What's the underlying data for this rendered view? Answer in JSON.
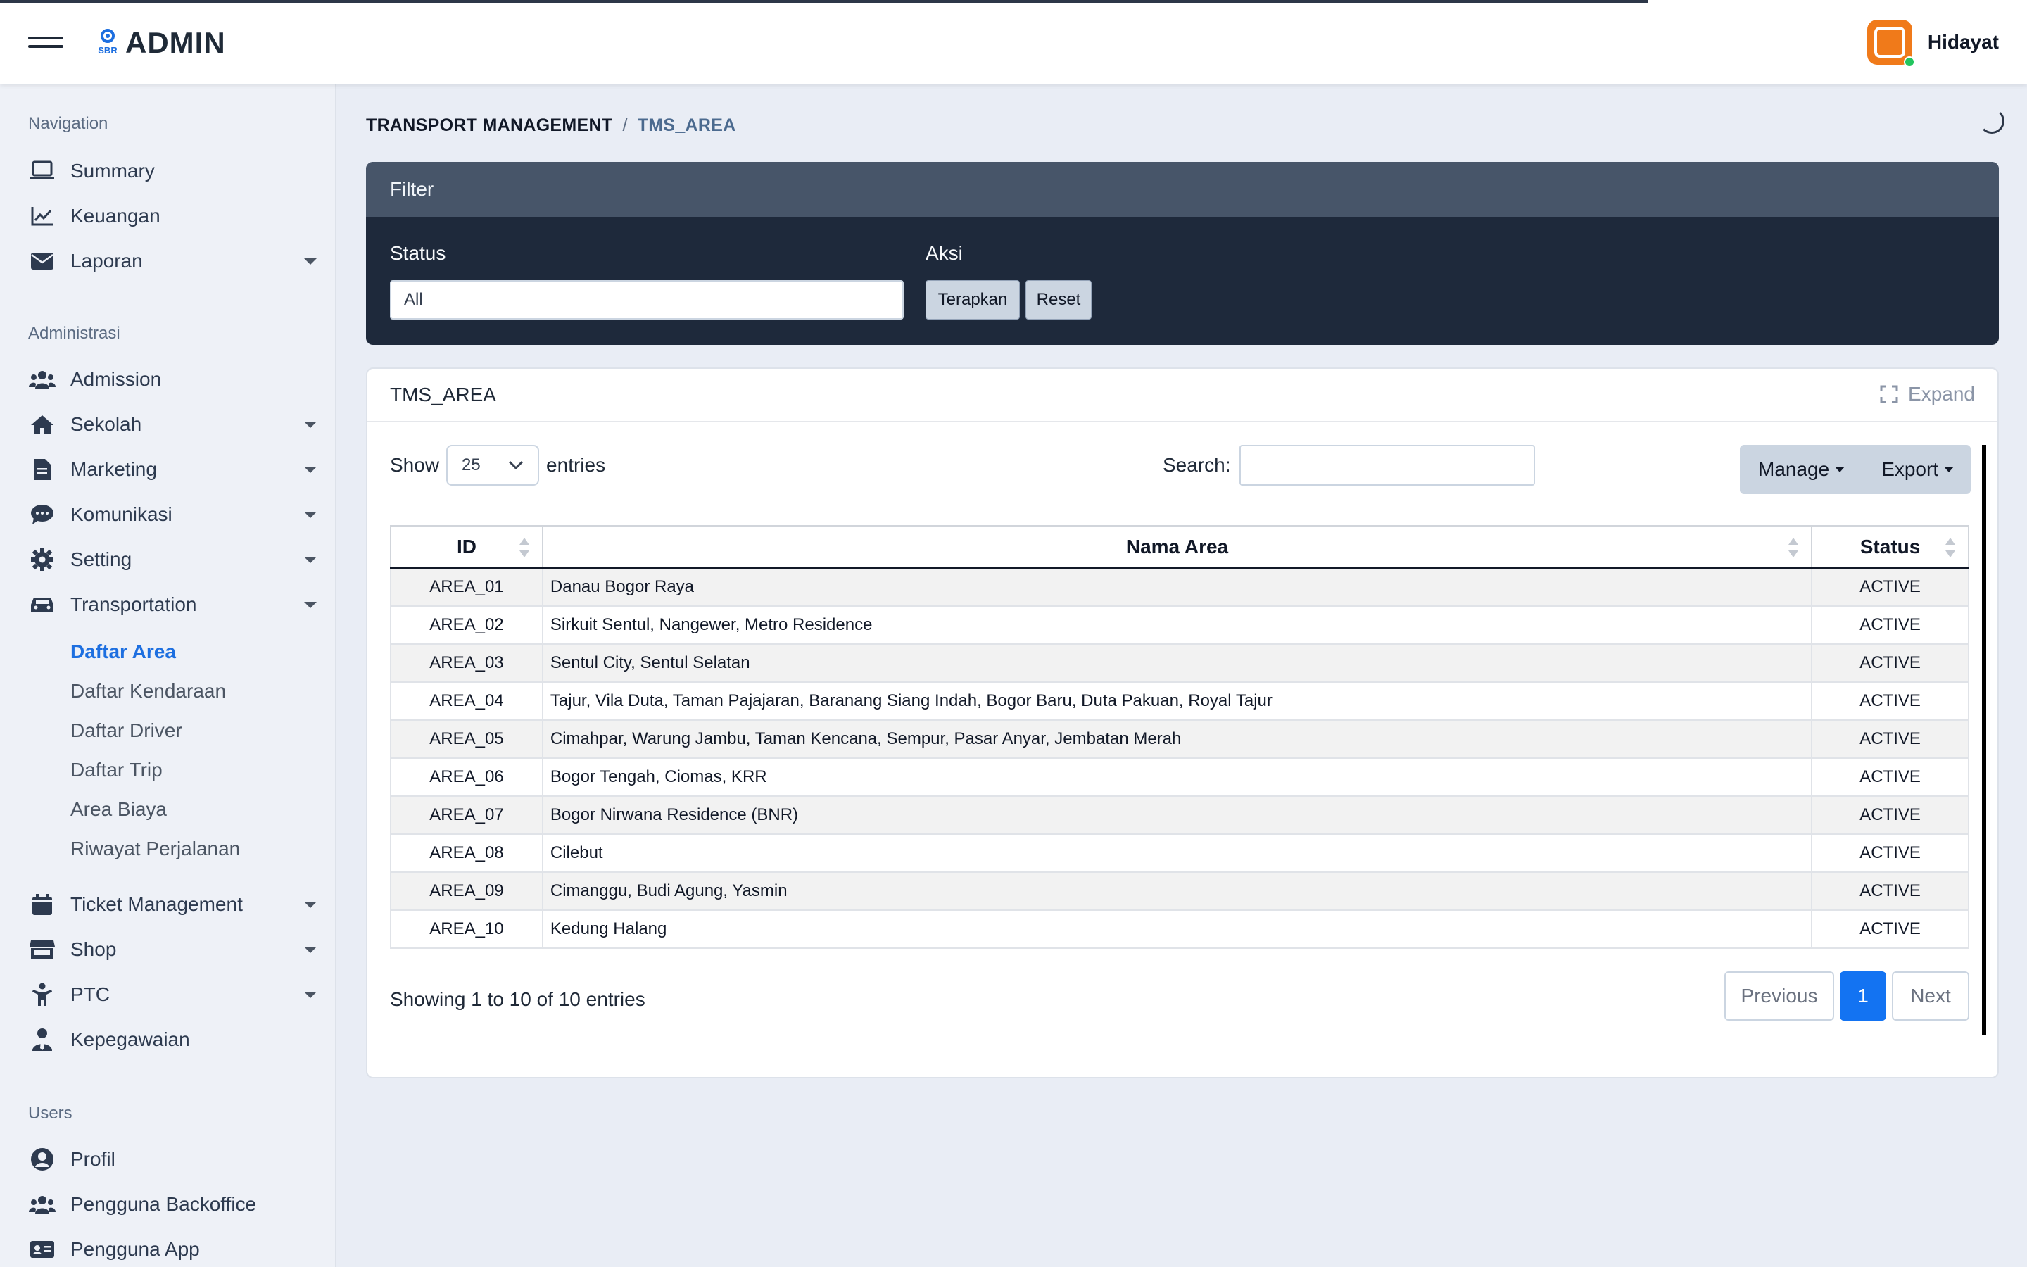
{
  "header": {
    "logo_mark": "SBR",
    "logo_text": "ADMIN",
    "user_name": "Hidayat"
  },
  "sidebar": {
    "sections": [
      {
        "title": "Navigation"
      },
      {
        "title": "Administrasi"
      },
      {
        "title": "Users"
      }
    ],
    "items": [
      {
        "label": "Summary",
        "icon": "laptop-icon"
      },
      {
        "label": "Keuangan",
        "icon": "chart-line-icon"
      },
      {
        "label": "Laporan",
        "icon": "envelope-icon"
      },
      {
        "label": "Admission",
        "icon": "users-icon"
      },
      {
        "label": "Sekolah",
        "icon": "home-icon"
      },
      {
        "label": "Marketing",
        "icon": "document-icon"
      },
      {
        "label": "Komunikasi",
        "icon": "chat-icon"
      },
      {
        "label": "Setting",
        "icon": "gear-icon"
      },
      {
        "label": "Transportation",
        "icon": "car-icon"
      },
      {
        "label": "Ticket Management",
        "icon": "calendar-icon"
      },
      {
        "label": "Shop",
        "icon": "store-icon"
      },
      {
        "label": "PTC",
        "icon": "child-icon"
      },
      {
        "label": "Kepegawaian",
        "icon": "user-tie-icon"
      },
      {
        "label": "Profil",
        "icon": "user-circle-icon"
      },
      {
        "label": "Pengguna Backoffice",
        "icon": "users-icon"
      },
      {
        "label": "Pengguna App",
        "icon": "id-card-icon"
      }
    ],
    "transport_sub": [
      {
        "label": "Daftar Area"
      },
      {
        "label": "Daftar Kendaraan"
      },
      {
        "label": "Daftar Driver"
      },
      {
        "label": "Daftar Trip"
      },
      {
        "label": "Area Biaya"
      },
      {
        "label": "Riwayat Perjalanan"
      }
    ]
  },
  "breadcrumb": {
    "parent": "TRANSPORT MANAGEMENT",
    "separator": "/",
    "current": "TMS_AREA"
  },
  "filter": {
    "title": "Filter",
    "status_label": "Status",
    "status_value": "All",
    "aksi_label": "Aksi",
    "apply_label": "Terapkan",
    "reset_label": "Reset"
  },
  "table_card": {
    "title": "TMS_AREA",
    "expand_label": "Expand",
    "show_label": "Show",
    "entries_label": "entries",
    "page_length": "25",
    "search_label": "Search:",
    "search_value": "",
    "manage_label": "Manage",
    "export_label": "Export",
    "columns": [
      "ID",
      "Nama Area",
      "Status"
    ],
    "rows": [
      {
        "id": "AREA_01",
        "name": "Danau Bogor Raya",
        "status": "ACTIVE"
      },
      {
        "id": "AREA_02",
        "name": "Sirkuit Sentul, Nangewer, Metro Residence",
        "status": "ACTIVE"
      },
      {
        "id": "AREA_03",
        "name": "Sentul City, Sentul Selatan",
        "status": "ACTIVE"
      },
      {
        "id": "AREA_04",
        "name": "Tajur, Vila Duta, Taman Pajajaran, Baranang Siang Indah, Bogor Baru, Duta Pakuan, Royal Tajur",
        "status": "ACTIVE"
      },
      {
        "id": "AREA_05",
        "name": "Cimahpar, Warung Jambu, Taman Kencana, Sempur, Pasar Anyar, Jembatan Merah",
        "status": "ACTIVE"
      },
      {
        "id": "AREA_06",
        "name": "Bogor Tengah, Ciomas, KRR",
        "status": "ACTIVE"
      },
      {
        "id": "AREA_07",
        "name": "Bogor Nirwana Residence (BNR)",
        "status": "ACTIVE"
      },
      {
        "id": "AREA_08",
        "name": "Cilebut",
        "status": "ACTIVE"
      },
      {
        "id": "AREA_09",
        "name": "Cimanggu, Budi Agung, Yasmin",
        "status": "ACTIVE"
      },
      {
        "id": "AREA_10",
        "name": "Kedung Halang",
        "status": "ACTIVE"
      }
    ],
    "info": "Showing 1 to 10 of 10 entries",
    "pagination": {
      "previous": "Previous",
      "current_page": "1",
      "next": "Next"
    }
  },
  "colors": {
    "accent": "#1373f2",
    "filter_bg": "#1e293b",
    "filter_header": "#475569",
    "avatar": "#f07a1a",
    "online": "#22c55e"
  }
}
